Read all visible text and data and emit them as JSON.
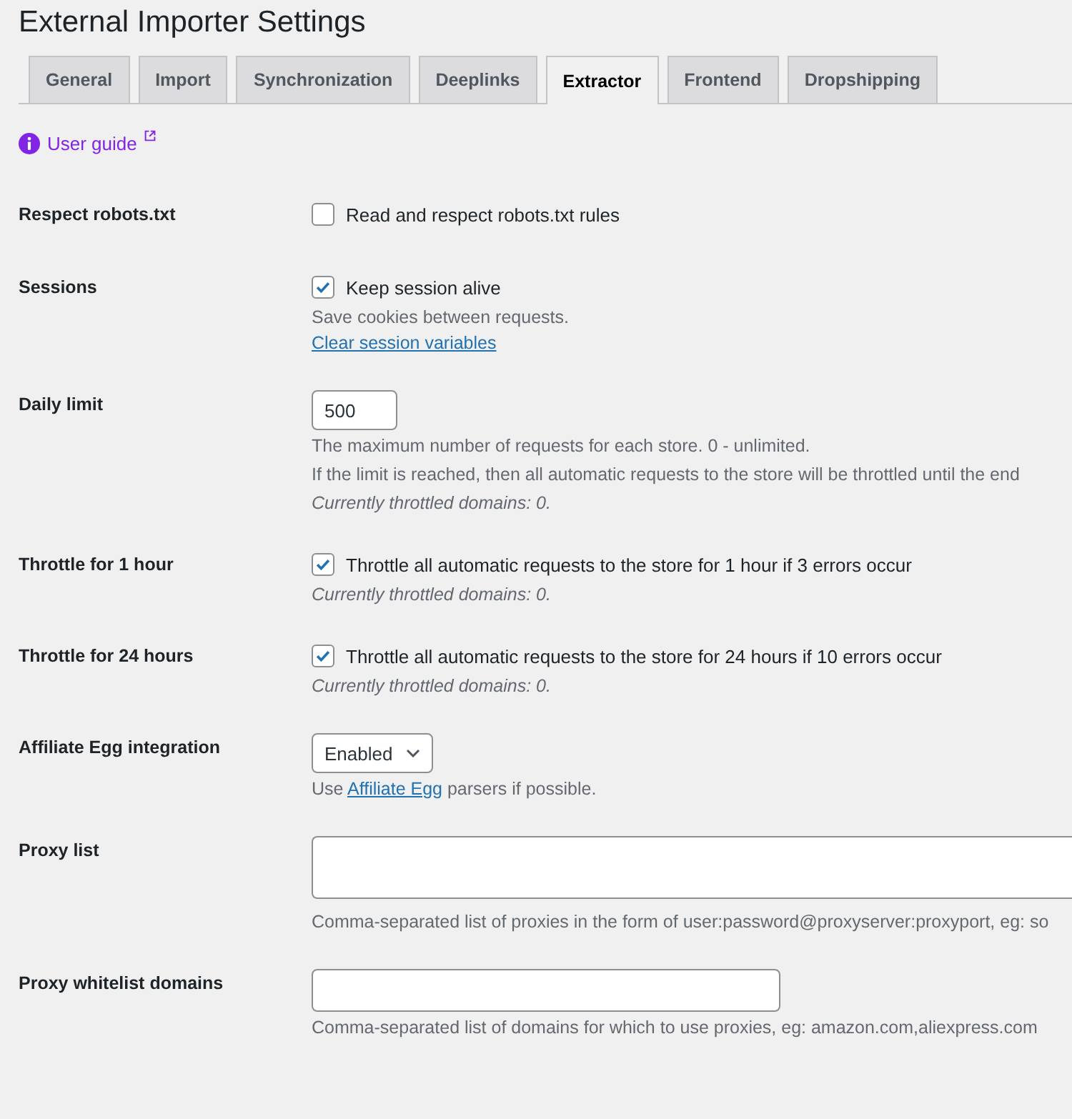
{
  "page_title": "External Importer Settings",
  "tabs": [
    {
      "label": "General",
      "selected": false
    },
    {
      "label": "Import",
      "selected": false
    },
    {
      "label": "Synchronization",
      "selected": false
    },
    {
      "label": "Deeplinks",
      "selected": false
    },
    {
      "label": "Extractor",
      "selected": true
    },
    {
      "label": "Frontend",
      "selected": false
    },
    {
      "label": "Dropshipping",
      "selected": false
    }
  ],
  "user_guide": {
    "label": "User guide"
  },
  "settings": [
    {
      "label": "Respect robots.txt",
      "items": [
        {
          "kind": "checkbox",
          "label": "Read and respect robots.txt rules",
          "checked": false
        }
      ]
    },
    {
      "label": "Sessions",
      "items": [
        {
          "kind": "checkbox",
          "label": "Keep session alive",
          "checked": true
        },
        {
          "kind": "description",
          "text": "Save cookies between requests."
        },
        {
          "kind": "link",
          "text": "Clear session variables"
        }
      ]
    },
    {
      "label": "Daily limit",
      "items": [
        {
          "kind": "number",
          "value": "500"
        },
        {
          "kind": "description",
          "text": "The maximum number of requests for each store. 0 - unlimited."
        },
        {
          "kind": "description",
          "text": "If the limit is reached, then all automatic requests to the store will be throttled until the end"
        },
        {
          "kind": "note",
          "text": "Currently throttled domains: 0."
        }
      ]
    },
    {
      "label": "Throttle for 1 hour",
      "items": [
        {
          "kind": "checkbox",
          "label": "Throttle all automatic requests to the store for 1 hour if 3 errors occur",
          "checked": true
        },
        {
          "kind": "note",
          "text": "Currently throttled domains: 0."
        }
      ]
    },
    {
      "label": "Throttle for 24 hours",
      "items": [
        {
          "kind": "checkbox",
          "label": "Throttle all automatic requests to the store for 24 hours if 10 errors occur",
          "checked": true
        },
        {
          "kind": "note",
          "text": "Currently throttled domains: 0."
        }
      ]
    },
    {
      "label": "Affiliate Egg integration",
      "items": [
        {
          "kind": "select",
          "value": "Enabled"
        },
        {
          "kind": "desc_link",
          "before": "Use",
          "link": "Affiliate Egg",
          "after": "parsers if possible."
        }
      ]
    },
    {
      "label": "Proxy list",
      "items": [
        {
          "kind": "textarea"
        },
        {
          "kind": "description",
          "text": "Comma-separated list of proxies in the form of user:password@proxyserver:proxyport, eg: so"
        }
      ]
    },
    {
      "label": "Proxy whitelist domains",
      "items": [
        {
          "kind": "text_input"
        },
        {
          "kind": "description",
          "text": "Comma-separated list of domains for which to use proxies, eg: amazon.com,aliexpress.com"
        }
      ]
    }
  ]
}
